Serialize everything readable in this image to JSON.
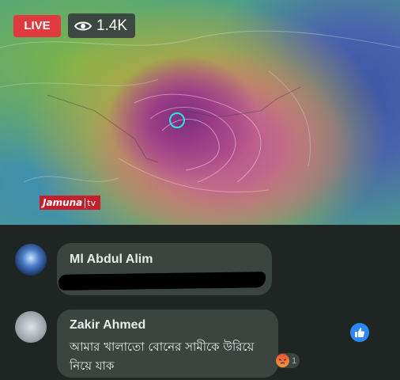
{
  "video": {
    "live_label": "LIVE",
    "viewer_count": "1.4K",
    "channel_name": "Jamuna",
    "channel_suffix": "tv"
  },
  "comments": [
    {
      "author": "Ml Abdul Alim",
      "text_redacted": true
    },
    {
      "author": "Zakir Ahmed",
      "text": "আমার খালাতো বোনের সামীকে উরিয়ে নিয়ে যাক",
      "reaction_count": "1"
    }
  ],
  "colors": {
    "live": "#e0393e",
    "like": "#2d88ff",
    "bubble": "#3b4540",
    "background": "#1e2522"
  },
  "icons": [
    "eye-icon",
    "like-icon",
    "angry-reaction-icon"
  ]
}
